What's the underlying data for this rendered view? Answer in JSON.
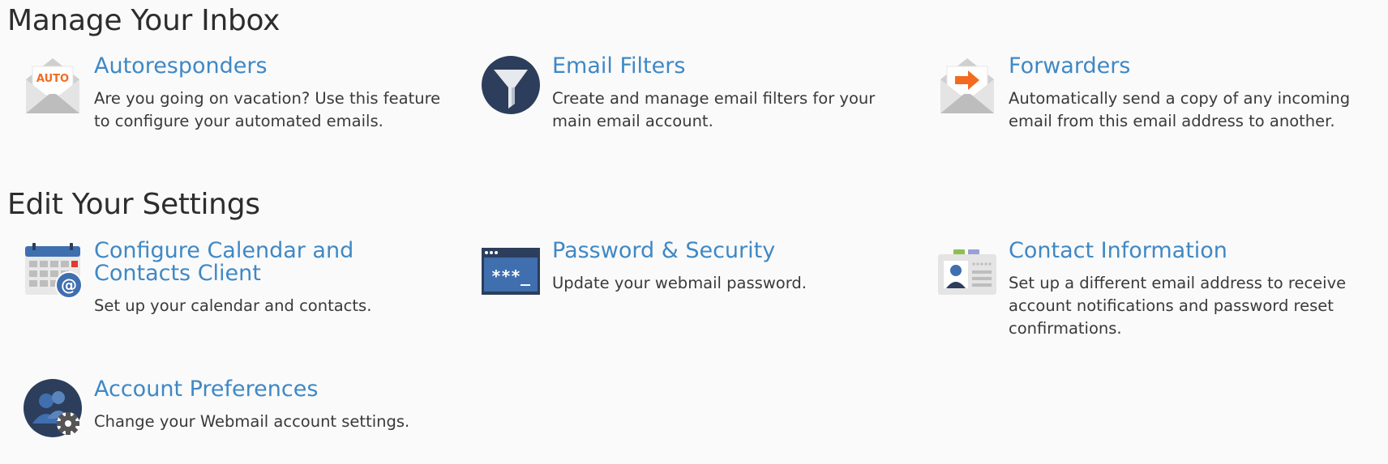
{
  "sections": [
    {
      "title": "Manage Your Inbox",
      "items": [
        {
          "label": "Autoresponders",
          "description": "Are you going on vacation? Use this feature to configure your automated emails.",
          "icon": "autoresponder-envelope-icon",
          "icon_text": "AUTO"
        },
        {
          "label": "Email Filters",
          "description": "Create and manage email filters for your main email account.",
          "icon": "funnel-icon"
        },
        {
          "label": "Forwarders",
          "description": "Automatically send a copy of any incoming email from this email address to another.",
          "icon": "forward-envelope-icon"
        }
      ]
    },
    {
      "title": "Edit Your Settings",
      "items": [
        {
          "label": "Configure Calendar and Contacts Client",
          "description": "Set up your calendar and contacts.",
          "icon": "calendar-at-icon"
        },
        {
          "label": "Password & Security",
          "description": "Update your webmail password.",
          "icon": "password-terminal-icon",
          "icon_text": "***_"
        },
        {
          "label": "Contact Information",
          "description": "Set up a different email address to receive account notifications and password reset confirmations.",
          "icon": "contact-card-icon"
        },
        {
          "label": "Account Preferences",
          "description": "Change your Webmail account settings.",
          "icon": "users-gear-icon"
        }
      ]
    }
  ],
  "colors": {
    "link": "#3f88c5",
    "heading": "#2d2d2d",
    "text": "#3a3a3a",
    "background": "#fafafa",
    "icon_navy": "#2c3e5c",
    "accent_orange": "#f26b21"
  }
}
